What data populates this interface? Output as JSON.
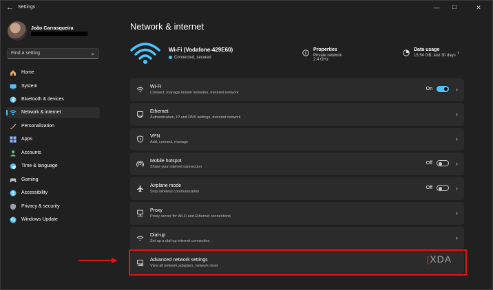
{
  "window": {
    "title": "Settings",
    "minimize": "—",
    "maximize": "☐",
    "close": "✕",
    "back_icon": "back-arrow-icon"
  },
  "user": {
    "name": "João Carrasqueira"
  },
  "search": {
    "placeholder": "Find a setting"
  },
  "sidebar": {
    "items": [
      {
        "label": "Home",
        "icon": "home-icon",
        "color": "#e8a25d"
      },
      {
        "label": "System",
        "icon": "monitor-icon",
        "color": "#4cc2ff"
      },
      {
        "label": "Bluetooth & devices",
        "icon": "bluetooth-icon",
        "color": "#4cc2ff"
      },
      {
        "label": "Network & internet",
        "icon": "wifi-icon",
        "color": "#4cc2ff",
        "active": true
      },
      {
        "label": "Personalization",
        "icon": "brush-icon",
        "color": "#e8a25d"
      },
      {
        "label": "Apps",
        "icon": "apps-icon",
        "color": "#8ab4f8"
      },
      {
        "label": "Accounts",
        "icon": "person-icon",
        "color": "#5fc47a"
      },
      {
        "label": "Time & language",
        "icon": "globe-clock-icon",
        "color": "#4cc2ff"
      },
      {
        "label": "Gaming",
        "icon": "gamepad-icon",
        "color": "#bdbdbd"
      },
      {
        "label": "Accessibility",
        "icon": "accessibility-icon",
        "color": "#4cc2ff"
      },
      {
        "label": "Privacy & security",
        "icon": "shield-icon",
        "color": "#9aa0a6"
      },
      {
        "label": "Windows Update",
        "icon": "update-icon",
        "color": "#4cc2ff"
      }
    ]
  },
  "page": {
    "title": "Network & internet"
  },
  "connection": {
    "name": "Wi-Fi (Vodafone-429E60)",
    "status": "Connected, secured",
    "properties": {
      "title": "Properties",
      "line1": "Private network",
      "line2": "2.4 GHz"
    },
    "data_usage": {
      "title": "Data usage",
      "line1": "15.54 GB, last 30 days"
    }
  },
  "rows": [
    {
      "title": "Wi-Fi",
      "subtitle": "Connect, manage known networks, metered network",
      "icon": "wifi-icon",
      "state": "On",
      "toggle": "on"
    },
    {
      "title": "Ethernet",
      "subtitle": "Authentication, IP and DNS settings, metered network",
      "icon": "ethernet-icon"
    },
    {
      "title": "VPN",
      "subtitle": "Add, connect, manage",
      "icon": "vpn-shield-icon"
    },
    {
      "title": "Mobile hotspot",
      "subtitle": "Share your internet connection",
      "icon": "hotspot-icon",
      "state": "Off",
      "toggle": "off"
    },
    {
      "title": "Airplane mode",
      "subtitle": "Stop wireless communication",
      "icon": "airplane-icon",
      "state": "Off",
      "toggle": "off"
    },
    {
      "title": "Proxy",
      "subtitle": "Proxy server for Wi-Fi and Ethernet connections",
      "icon": "proxy-icon"
    },
    {
      "title": "Dial-up",
      "subtitle": "Set up a dial-up internet connection",
      "icon": "dialup-icon"
    },
    {
      "title": "Advanced network settings",
      "subtitle": "View all network adapters, network reset",
      "icon": "network-adapter-icon"
    }
  ],
  "annotation": {
    "highlight_color": "#e01515"
  },
  "watermark": "XDA"
}
